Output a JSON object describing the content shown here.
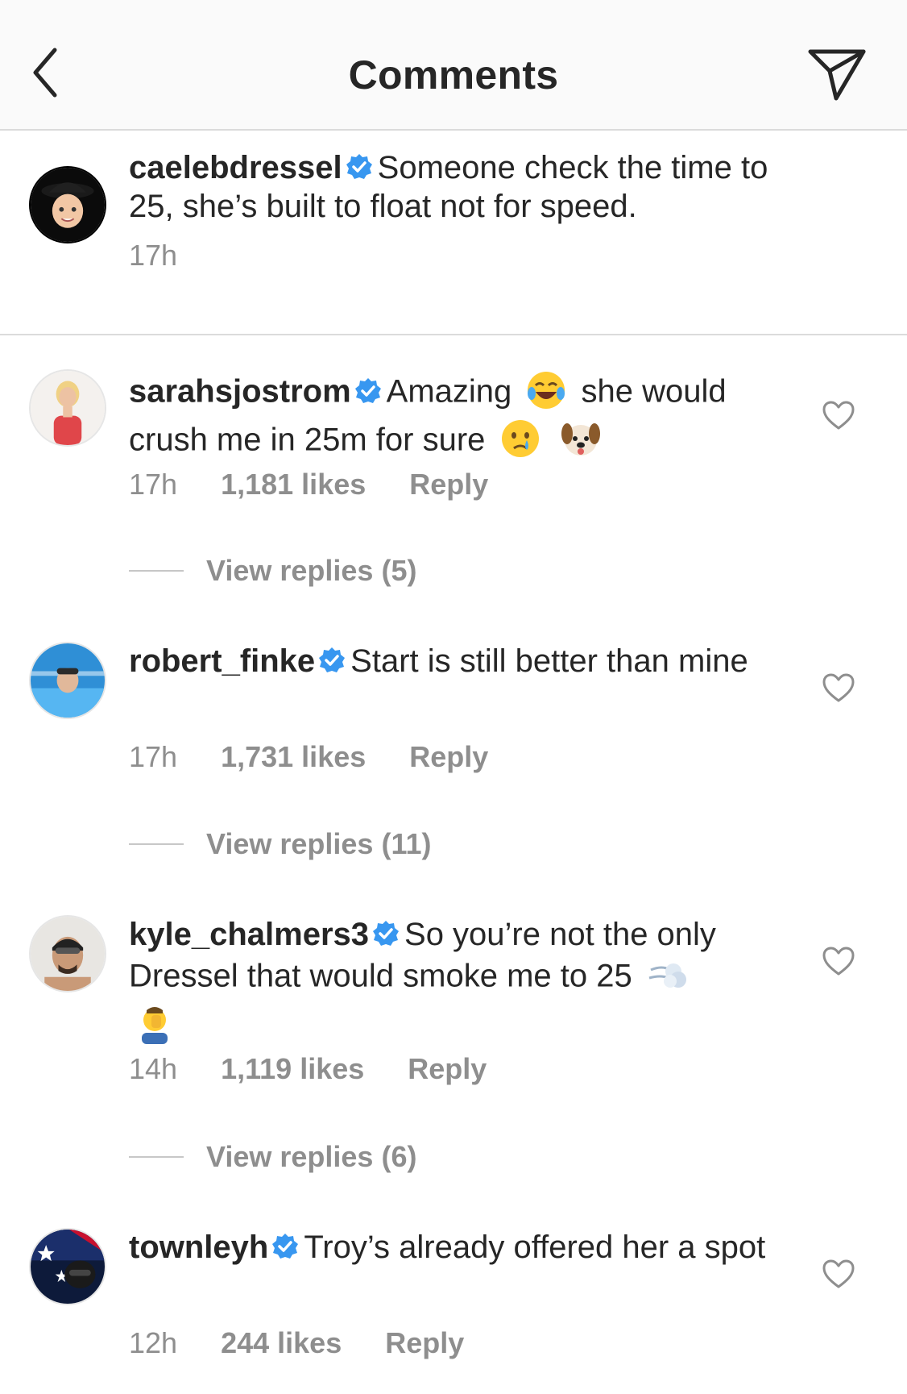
{
  "header": {
    "title": "Comments"
  },
  "caption": {
    "username": "caelebdressel",
    "text": "Someone check the time to 25, she’s built to float not for speed.",
    "time": "17h"
  },
  "comments": [
    {
      "username": "sarahsjostrom",
      "text_1": "Amazing",
      "text_2": "she would crush me in 25m for sure",
      "emojis": [
        "tears-of-joy-emoji",
        "crying-face-emoji",
        "dog-face-emoji"
      ],
      "time": "17h",
      "likes": "1,181 likes",
      "reply": "Reply",
      "view_replies": "View replies (5)"
    },
    {
      "username": "robert_finke",
      "text": "Start is still better than mine",
      "time": "17h",
      "likes": "1,731 likes",
      "reply": "Reply",
      "view_replies": "View replies (11)"
    },
    {
      "username": "kyle_chalmers3",
      "text": "So you’re not the only Dressel that would smoke me to 25",
      "emojis": [
        "dashing-away-emoji",
        "facepalm-emoji"
      ],
      "time": "14h",
      "likes": "1,119 likes",
      "reply": "Reply",
      "view_replies": "View replies (6)"
    },
    {
      "username": "townleyh",
      "text": "Troy’s already offered her a spot",
      "time": "12h",
      "likes": "244 likes",
      "reply": "Reply"
    }
  ],
  "colors": {
    "verified_badge": "#3897f0",
    "secondary_text": "#8e8e8e",
    "primary_text": "#262626",
    "divider": "#dbdbdb"
  }
}
